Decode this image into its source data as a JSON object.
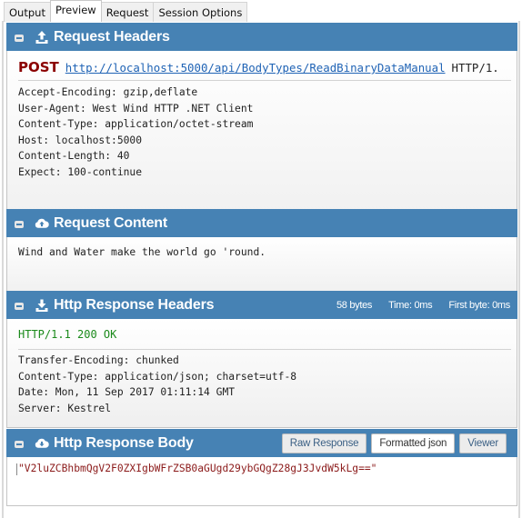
{
  "tabs": [
    {
      "label": "Output",
      "active": false
    },
    {
      "label": "Preview",
      "active": true
    },
    {
      "label": "Request",
      "active": false
    },
    {
      "label": "Session Options",
      "active": false
    }
  ],
  "request_headers": {
    "title": "Request Headers",
    "icon": "upload-icon",
    "verb": "POST",
    "url": "http://localhost:5000/api/BodyTypes/ReadBinaryDataManual",
    "protocol": "HTTP/1.",
    "headers": [
      "Accept-Encoding: gzip,deflate",
      "User-Agent: West Wind HTTP .NET Client",
      "Content-Type: application/octet-stream",
      "Host: localhost:5000",
      "Content-Length: 40",
      "Expect: 100-continue"
    ],
    "scroll_left": "‹",
    "scroll_right": "›"
  },
  "request_content": {
    "title": "Request Content",
    "icon": "cloud-upload-icon",
    "body": "Wind and Water make the world go 'round."
  },
  "response_headers": {
    "title": "Http Response Headers",
    "icon": "download-icon",
    "size": "58 bytes",
    "time": "Time: 0ms",
    "first_byte": "First byte: 0ms",
    "status": "HTTP/1.1 200 OK",
    "headers": [
      "Transfer-Encoding: chunked",
      "Content-Type: application/json; charset=utf-8",
      "Date: Mon, 11 Sep 2017 01:11:14 GMT",
      "Server: Kestrel"
    ]
  },
  "response_body": {
    "title": "Http Response Body",
    "icon": "cloud-download-icon",
    "buttons": {
      "raw": "Raw Response",
      "formatted": "Formatted json",
      "viewer": "Viewer"
    },
    "active_button": "formatted",
    "body": "\"V2luZCBhbmQgV2F0ZXIgbWFrZSB0aGUgd29ybGQgZ28gJ3JvdW5kLg==\""
  },
  "colors": {
    "header_bg": "#4682b4",
    "verb": "#8b0000",
    "url": "#1f63b5",
    "status_ok": "#1b8a1b",
    "response_text": "#8b1a1a"
  }
}
